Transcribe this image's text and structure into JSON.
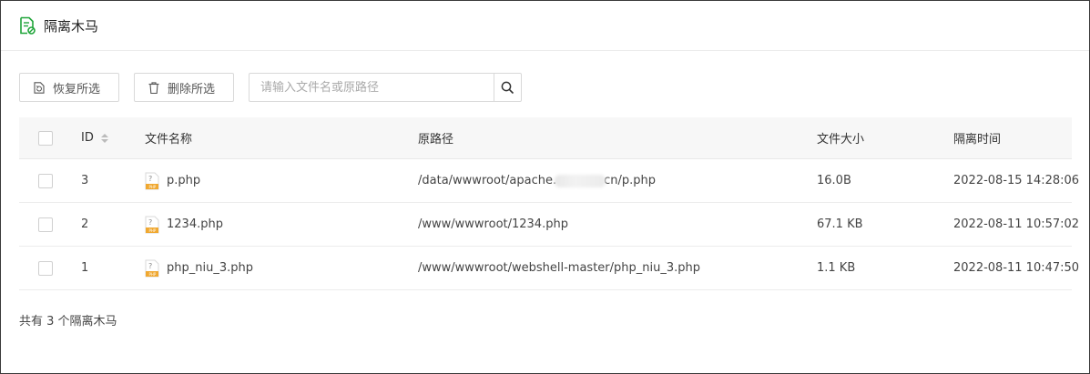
{
  "header": {
    "title": "隔离木马",
    "icon": "quarantine-file-icon"
  },
  "toolbar": {
    "restore_label": "恢复所选",
    "delete_label": "删除所选",
    "search_placeholder": "请输入文件名或原路径"
  },
  "table": {
    "columns": {
      "id": "ID",
      "name": "文件名称",
      "path": "原路径",
      "size": "文件大小",
      "time": "隔离时间"
    },
    "rows": [
      {
        "id": "3",
        "name": "p.php",
        "path_start": "/data/wwwroot/apache.",
        "path_end": "cn/p.php",
        "size": "16.0B",
        "time": "2022-08-15 14:28:06"
      },
      {
        "id": "2",
        "name": "1234.php",
        "path": "/www/wwwroot/1234.php",
        "size": "67.1 KB",
        "time": "2022-08-11 10:57:02"
      },
      {
        "id": "1",
        "name": "php_niu_3.php",
        "path": "/www/wwwroot/webshell-master/php_niu_3.php",
        "size": "1.1 KB",
        "time": "2022-08-11 10:47:50"
      }
    ]
  },
  "footer": {
    "summary": "共有 3 个隔离木马"
  },
  "colors": {
    "accent_green": "#20a53a",
    "php_icon": "#f0a830",
    "border": "#d9d9d9",
    "header_bg": "#f7f7f7"
  }
}
